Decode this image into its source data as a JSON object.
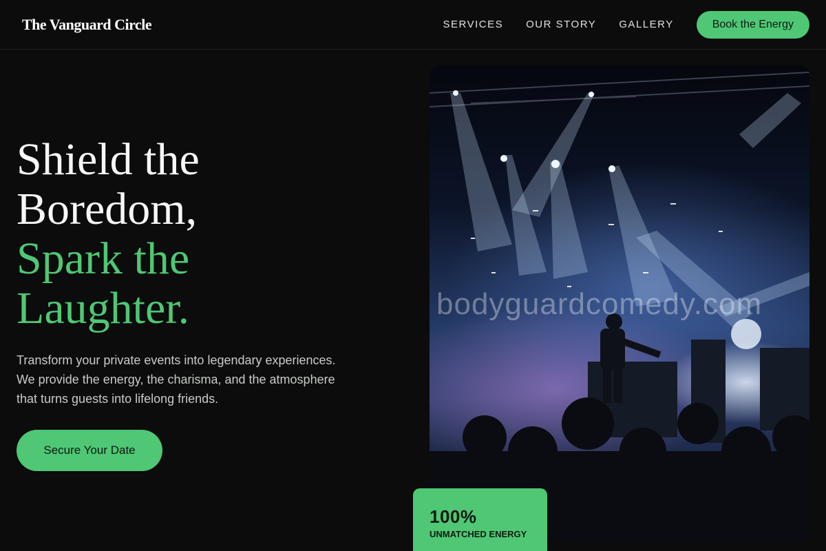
{
  "header": {
    "brand": "The Vanguard Circle",
    "nav": [
      "SERVICES",
      "OUR STORY",
      "GALLERY"
    ],
    "cta_label": "Book the Energy"
  },
  "hero": {
    "title_line1": "Shield the",
    "title_line2": "Boredom,",
    "title_line3": "Spark the",
    "title_line4": "Laughter.",
    "description_line1": "Transform your private events into legendary experiences.",
    "description_line2": "We provide the energy, the charisma, and the atmosphere",
    "description_line3": "that turns guests into lifelong friends.",
    "cta_label": "Secure Your Date"
  },
  "photo": {
    "watermark": "bodyguardcomedy.com"
  },
  "stat": {
    "value": "100%",
    "label": "UNMATCHED ENERGY"
  },
  "colors": {
    "accent": "#4fc775",
    "background": "#0b0c0b"
  }
}
